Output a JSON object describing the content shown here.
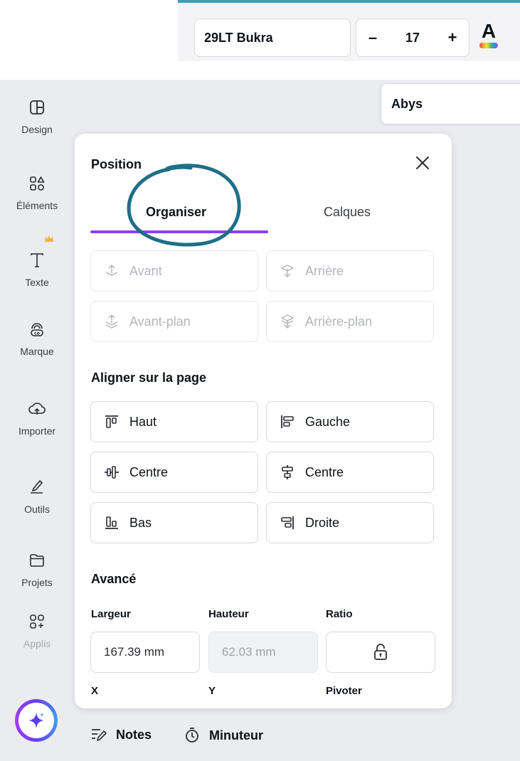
{
  "toolbar": {
    "font_name": "29LT Bukra",
    "font_size": "17",
    "decrease_label": "–",
    "increase_label": "+",
    "text_color_letter": "A"
  },
  "secondary_font": "Abys",
  "sidebar": {
    "items": [
      {
        "label": "Design",
        "icon": "layout-icon"
      },
      {
        "label": "Éléments",
        "icon": "shapes-icon"
      },
      {
        "label": "Texte",
        "icon": "text-icon"
      },
      {
        "label": "Marque",
        "icon": "brand-icon"
      },
      {
        "label": "Importer",
        "icon": "upload-cloud-icon"
      },
      {
        "label": "Outils",
        "icon": "draw-icon"
      },
      {
        "label": "Projets",
        "icon": "folder-icon"
      },
      {
        "label": "Applis",
        "icon": "apps-icon"
      }
    ]
  },
  "panel": {
    "title": "Position",
    "tabs": [
      {
        "label": "Organiser",
        "active": true
      },
      {
        "label": "Calques",
        "active": false
      }
    ],
    "layer_buttons": {
      "forward": "Avant",
      "backward": "Arrière",
      "to_front": "Avant-plan",
      "to_back": "Arrière-plan"
    },
    "align_title": "Aligner sur la page",
    "align_buttons": {
      "top": "Haut",
      "left": "Gauche",
      "middle": "Centre",
      "center": "Centre",
      "bottom": "Bas",
      "right": "Droite"
    },
    "advanced_title": "Avancé",
    "width_label": "Largeur",
    "height_label": "Hauteur",
    "ratio_label": "Ratio",
    "width_value": "167.39 mm",
    "height_value": "62.03 mm",
    "x_label": "X",
    "y_label": "Y",
    "rotate_label": "Pivoter"
  },
  "bottom_bar": {
    "notes": "Notes",
    "timer": "Minuteur"
  },
  "colors": {
    "accent_purple": "#8b3ef5",
    "annotation_teal": "#1f6e87",
    "canvas_bg": "#ebecf0"
  }
}
